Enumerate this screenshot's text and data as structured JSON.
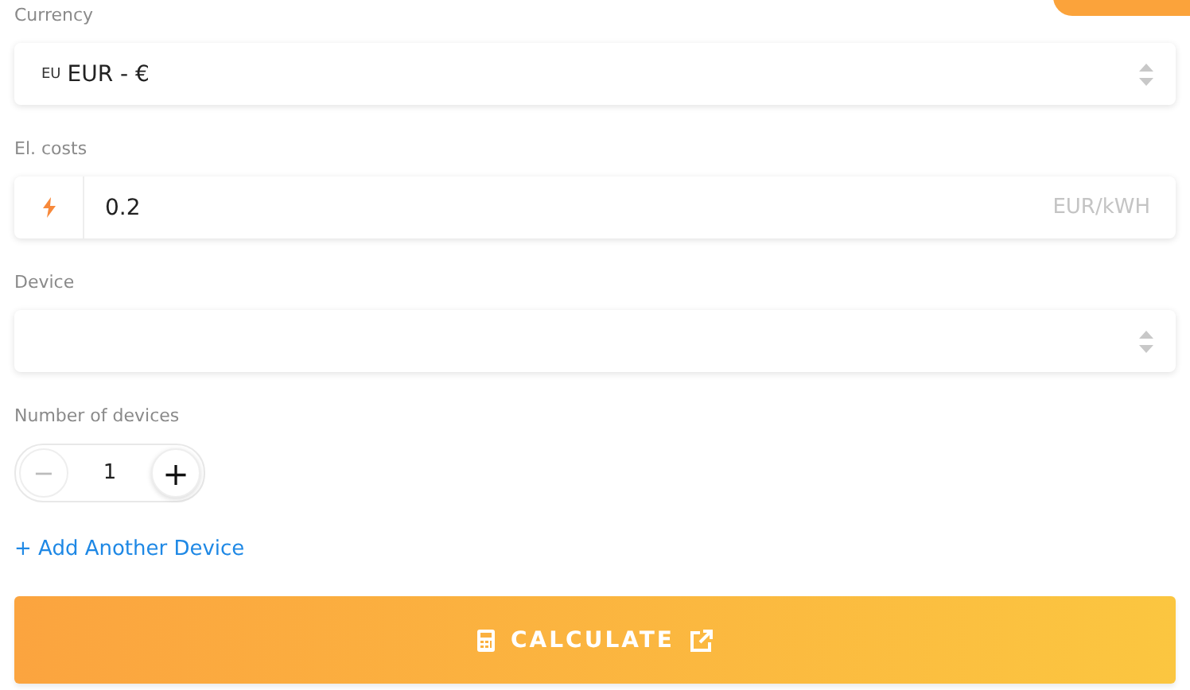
{
  "currency": {
    "label": "Currency",
    "flag": "EU",
    "value": "EUR - €"
  },
  "el_costs": {
    "label": "El. costs",
    "value": "0.2",
    "unit": "EUR/kWH"
  },
  "device": {
    "label": "Device"
  },
  "number_of_devices": {
    "label": "Number of devices",
    "minus": "−",
    "value": "1",
    "plus": "+"
  },
  "add_link": "+ Add Another Device",
  "calculate_button": "CALCULATE"
}
